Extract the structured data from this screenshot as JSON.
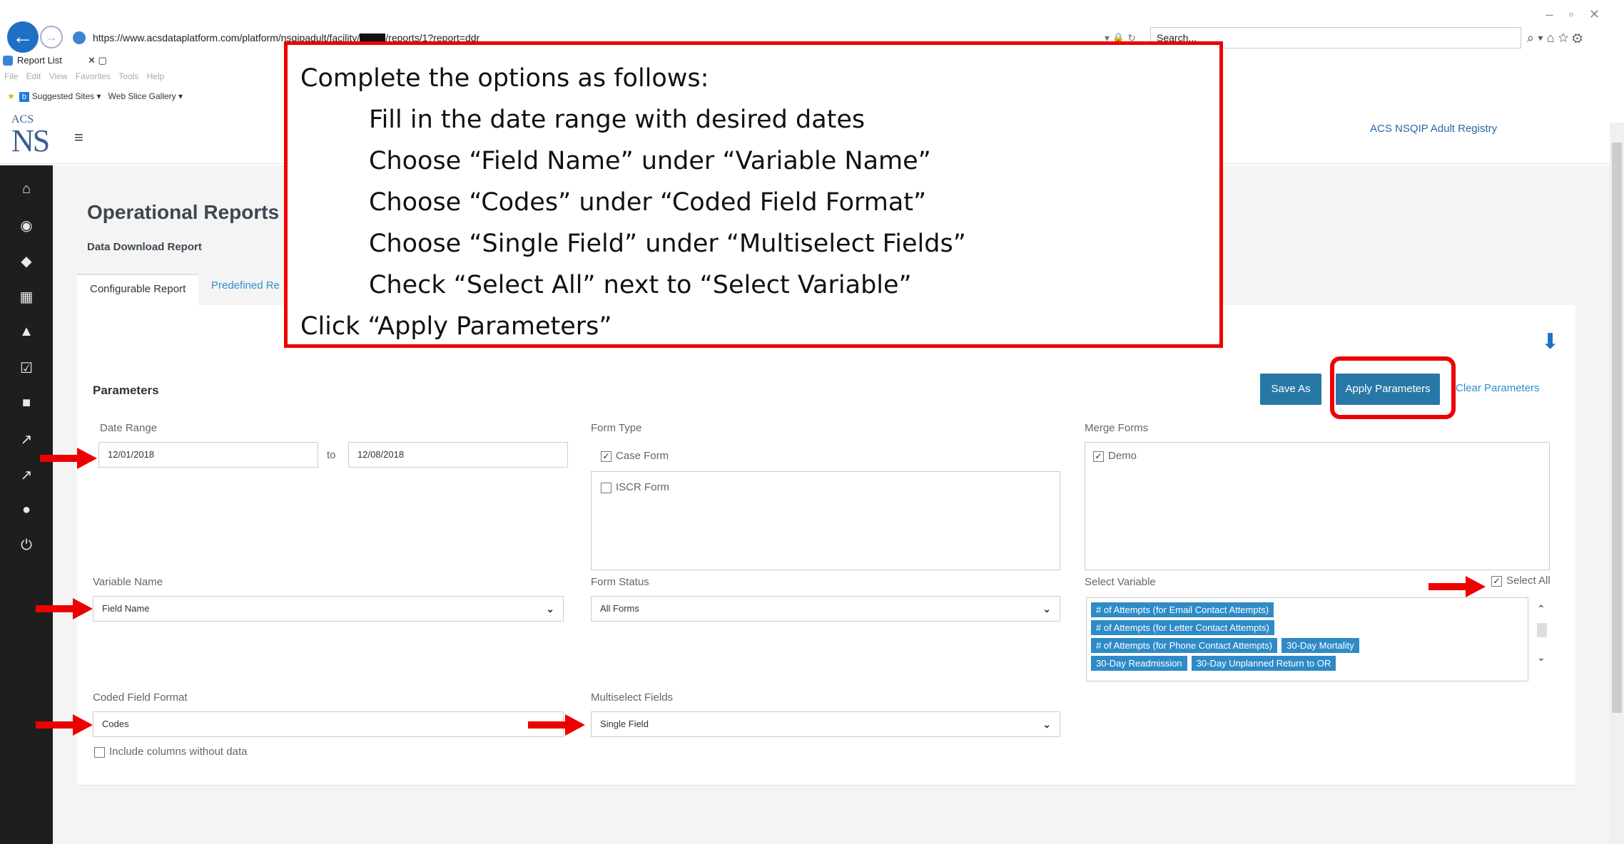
{
  "browser": {
    "url": "https://www.acsdataplatform.com/platform/nsqipadult/facility/",
    "url_tail": "/reports/1?report=ddr",
    "search_placeholder": "Search...",
    "tab_title": "Report List",
    "menu": "File Edit View Favorites Tools Help",
    "fav_suggested": "Suggested Sites ▾",
    "fav_webslice": "Web Slice Gallery ▾"
  },
  "app": {
    "logo_top": "ACS",
    "logo_main": "NS",
    "registry": "ACS NSQIP Adult Registry",
    "page_title": "Operational Reports",
    "page_subtitle": "Data Download Report",
    "tabs": [
      "Configurable Report",
      "Predefined Re"
    ]
  },
  "parameters": {
    "title": "Parameters",
    "save_as": "Save As",
    "apply": "Apply Parameters",
    "clear": "Clear Parameters",
    "date_range_label": "Date Range",
    "date_from": "12/01/2018",
    "date_to_sep": "to",
    "date_to": "12/08/2018",
    "form_type_label": "Form Type",
    "form_types": [
      {
        "label": "Case Form",
        "checked": true
      },
      {
        "label": "ISCR Form",
        "checked": false
      }
    ],
    "merge_forms_label": "Merge Forms",
    "merge_forms": [
      {
        "label": "Demo",
        "checked": true
      }
    ],
    "variable_name_label": "Variable Name",
    "variable_name_value": "Field Name",
    "form_status_label": "Form Status",
    "form_status_value": "All Forms",
    "select_variable_label": "Select Variable",
    "select_all_label": "Select All",
    "select_all_checked": true,
    "variables": [
      "# of Attempts (for Email Contact Attempts)",
      "# of Attempts (for Letter Contact Attempts)",
      "# of Attempts (for Phone Contact Attempts)",
      "30-Day Mortality",
      "30-Day Readmission",
      "30-Day Unplanned Return to OR"
    ],
    "coded_format_label": "Coded Field Format",
    "coded_format_value": "Codes",
    "include_empty_label": "Include columns without data",
    "multiselect_label": "Multiselect Fields",
    "multiselect_value": "Single Field"
  },
  "callout": {
    "line1": "Complete the options as follows:",
    "line2": "Fill in the date range with desired dates",
    "line3": "Choose “Field Name” under “Variable Name”",
    "line4": "Choose “Codes” under “Coded Field Format”",
    "line5": "Choose “Single Field” under “Multiselect Fields”",
    "line6": "Check “Select All” next to “Select Variable”",
    "line7": "Click “Apply Parameters”"
  },
  "colors": {
    "highlight": "#e00000",
    "button": "#2778a6",
    "tag": "#2e8bc7",
    "sidebar": "#1e1e1e"
  }
}
